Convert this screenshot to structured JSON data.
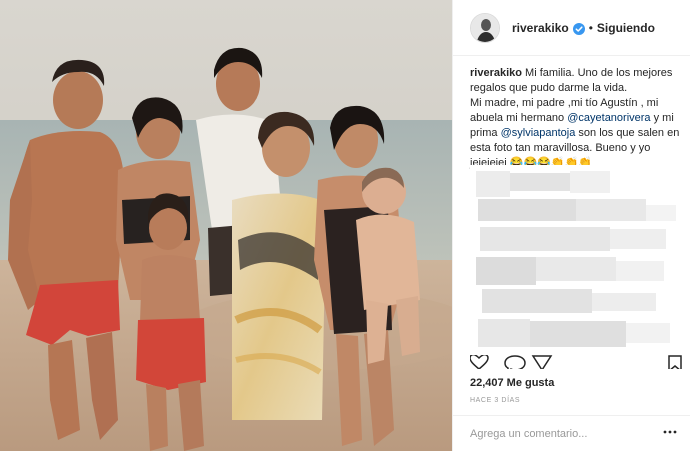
{
  "post": {
    "author": "riverakiko",
    "follow_status": "Siguiendo",
    "separator": "•",
    "caption": {
      "author": "riverakiko",
      "text_1": "Mi familia. Uno de los mejores regalos que pudo darme la vida.",
      "text_2": "Mi madre, mi padre ,mi tío Agustín , mi abuela mi hermano",
      "mention_1": "@cayetanorivera",
      "text_3": "y mi prima",
      "mention_2": "@sylviapantoja",
      "text_4": "son los que salen en esta foto tan maravillosa. Bueno y yo jejejejej",
      "emojis": "😂😂😂👏👏👏"
    },
    "likes_count": "22,407",
    "likes_label": "Me gusta",
    "time_ago": "HACE 3 DÍAS",
    "comment_placeholder": "Agrega un comentario..."
  },
  "icons": {
    "verified": "verified-badge-icon",
    "more": "more-options-icon",
    "like": "heart-icon",
    "comment": "comment-icon",
    "share": "share-icon",
    "save": "bookmark-icon"
  },
  "colors": {
    "verified_blue": "#3897f0",
    "mention": "#003569",
    "muted": "#999999",
    "text": "#262626"
  }
}
